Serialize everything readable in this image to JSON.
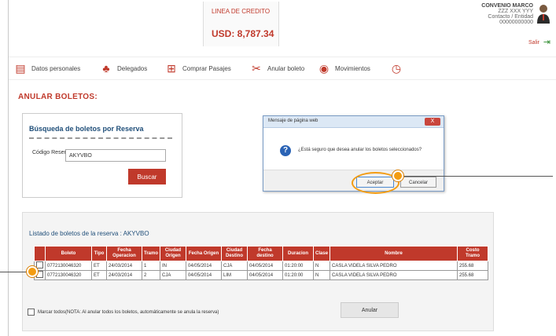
{
  "credit": {
    "label": "LINEA DE CREDITO",
    "amount": "USD: 8,787.34"
  },
  "user": {
    "line1": "CONVENIO MARCO",
    "line2": "ZZZ XXX YYY",
    "line3": "Contacto / Entidad",
    "line4": "00000000000",
    "logout": "Salir"
  },
  "nav": {
    "items": [
      {
        "label": "Datos personales",
        "icon": "id-card-icon"
      },
      {
        "label": "Delegados",
        "icon": "users-icon"
      },
      {
        "label": "Comprar Pasajes",
        "icon": "cart-icon"
      },
      {
        "label": "Anular boleto",
        "icon": "scissors-icon"
      },
      {
        "label": "Movimientos",
        "icon": "globe-icon"
      },
      {
        "label": "",
        "icon": "clock-icon"
      }
    ]
  },
  "page": {
    "title": "ANULAR BOLETOS:"
  },
  "search": {
    "title": "Búsqueda de boletos por Reserva",
    "field_label": "Código Reserva:",
    "field_value": "AKYVBO",
    "button": "Buscar"
  },
  "dialog": {
    "title": "Mensaje de página web",
    "message": "¿Está seguro que desea anular los boletos seleccionados?",
    "ok": "Aceptar",
    "cancel": "Cancelar",
    "close": "X"
  },
  "results": {
    "title": "Listado de boletos de la reserva : AKYVBO",
    "columns": [
      "",
      "Boleto",
      "Tipo",
      "Fecha Operacion",
      "Tramo",
      "Ciudad Origen",
      "Fecha Origen",
      "Ciudad Destino",
      "Fecha destino",
      "Duracion",
      "Clase",
      "Nombre",
      "Costo Tramo"
    ],
    "rows": [
      [
        "",
        "0772130046320",
        "ET",
        "24/03/2014",
        "1",
        "IN",
        "04/05/2014",
        "CJA",
        "04/05/2014",
        "01:20:00",
        "N",
        "CASLA VIDELA SILVA PEDRO",
        "255.68"
      ],
      [
        "",
        "0772130046320",
        "ET",
        "24/03/2014",
        "2",
        "CJA",
        "04/05/2014",
        "LIM",
        "04/05/2014",
        "01:20:00",
        "N",
        "CASLA VIDELA SILVA PEDRO",
        "255.68"
      ]
    ],
    "mark_all": "Marcar todos(NOTA: Al anular todos los boletos, automáticamente se anula la reserva)",
    "anular_button": "Anular"
  },
  "colors": {
    "accent": "#c0392b",
    "callout": "#f39c12"
  }
}
